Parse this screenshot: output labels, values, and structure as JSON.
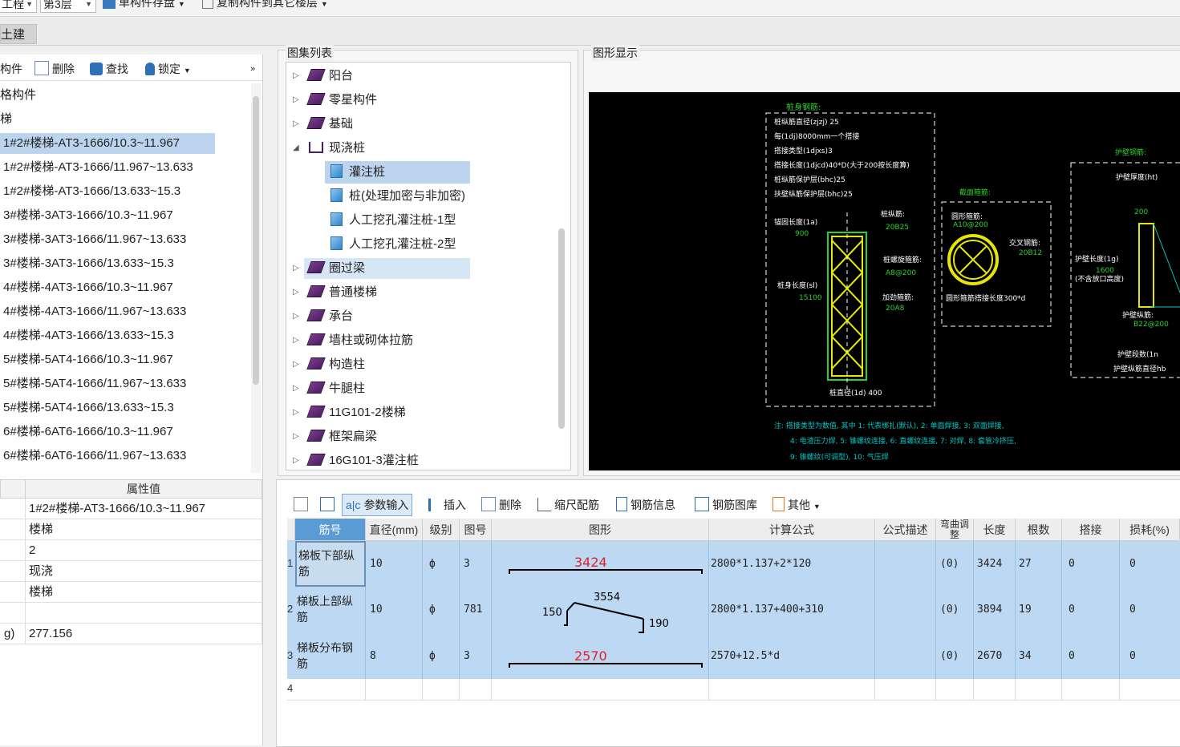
{
  "toolbar": {
    "project_combo": "工程",
    "floor_combo": "第3层",
    "save_single": "单构件存盘",
    "copy_to_floors": "复制构件到其它楼层"
  },
  "tabs": {
    "tujian": "土建"
  },
  "left_toolbar": {
    "component": "构件",
    "delete": "删除",
    "find": "查找",
    "lock": "锁定"
  },
  "left_tree": {
    "group1": "格构件",
    "group2": "梯",
    "items": [
      "1#2#楼梯-AT3-1666/10.3~11.967",
      "1#2#楼梯-AT3-1666/11.967~13.633",
      "1#2#楼梯-AT3-1666/13.633~15.3",
      "3#楼梯-3AT3-1666/10.3~11.967",
      "3#楼梯-3AT3-1666/11.967~13.633",
      "3#楼梯-3AT3-1666/13.633~15.3",
      "4#楼梯-4AT3-1666/10.3~11.967",
      "4#楼梯-4AT3-1666/11.967~13.633",
      "4#楼梯-4AT3-1666/13.633~15.3",
      "5#楼梯-5AT4-1666/10.3~11.967",
      "5#楼梯-5AT4-1666/11.967~13.633",
      "5#楼梯-5AT4-1666/13.633~15.3",
      "6#楼梯-6AT6-1666/10.3~11.967",
      "6#楼梯-6AT6-1666/11.967~13.633"
    ]
  },
  "props": {
    "header_value": "属性值",
    "rows": [
      {
        "name": "",
        "value": "1#2#楼梯-AT3-1666/10.3~11.967"
      },
      {
        "name": "",
        "value": "楼梯"
      },
      {
        "name": "",
        "value": "2"
      },
      {
        "name": "",
        "value": "现浇"
      },
      {
        "name": "",
        "value": "楼梯"
      },
      {
        "name": "",
        "value": ""
      },
      {
        "name": "g)",
        "value": "277.156"
      }
    ]
  },
  "atlas": {
    "title": "图集列表",
    "items": [
      {
        "label": "阳台"
      },
      {
        "label": "零星构件"
      },
      {
        "label": "基础"
      },
      {
        "label": "现浇桩"
      },
      {
        "label": "灌注桩"
      },
      {
        "label": "桩(处理加密与非加密)"
      },
      {
        "label": "人工挖孔灌注桩-1型"
      },
      {
        "label": "人工挖孔灌注桩-2型"
      },
      {
        "label": "圈过梁"
      },
      {
        "label": "普通楼梯"
      },
      {
        "label": "承台"
      },
      {
        "label": "墙柱或砌体拉筋"
      },
      {
        "label": "构造柱"
      },
      {
        "label": "牛腿柱"
      },
      {
        "label": "11G101-2楼梯"
      },
      {
        "label": "框架扁梁"
      },
      {
        "label": "16G101-3灌注桩"
      }
    ]
  },
  "graphic": {
    "title": "图形显示",
    "colors": {
      "bg": "#000000",
      "frame": "#ffffff",
      "green": "#2ad22a",
      "yellow": "#e6e600",
      "cyan": "#00c8c8"
    },
    "pile_rebar_title": "桩身钢筋:",
    "lines": [
      "桩纵筋直径(zjzj) 25",
      "每(1dj)8000mm一个搭接",
      "搭接类型(1djxs)3",
      "搭接长度(1djcd)40*D(大于200按长度算)",
      "桩纵筋保护层(bhc)25",
      "扶壁纵筋保护层(bhc)25"
    ],
    "anchor_len": "锚固长度(1a)",
    "anchor_val": "900",
    "pile_long": "桩纵筋:",
    "pile_long_val": "20B25",
    "spiral": "桩螺旋箍筋:",
    "spiral_val": "A8@200",
    "body_len": "桩身长度(sl)",
    "body_len_val": "15100",
    "stiff": "加劲箍筋:",
    "stiff_val": "20A8",
    "pile_dia": "桩直径(1d) 400",
    "section_title": "截面箍筋:",
    "circle_hoop": "圆形箍筋:",
    "circle_hoop_val": "A10@200",
    "cross": "交叉钢筋:",
    "cross_val": "20B12",
    "circle_lap": "圆形箍筋搭接长度300*d",
    "wall_title": "护壁钢筋:",
    "wall_thick": "护壁厚度(ht)",
    "wall_200": "200",
    "wall_len": "护壁长度(1g)",
    "wall_len_val": "1600",
    "wall_note": "(不含放口高度)",
    "wall_long": "护壁纵筋:",
    "wall_long_val": "B22@200",
    "wall_seg": "护壁段数(1n",
    "wall_dia": "护壁纵筋直径hb",
    "note1": "注: 搭接类型为数值, 其中 1: 代表绑扎(默认), 2: 单面焊接, 3: 双面焊接,",
    "note2": "4: 电渣压力焊, 5: 锥螺纹连接, 6: 直螺纹连接, 7: 对焊, 8: 套管冷挤压,",
    "note3": "9: 锥螺纹(可调型), 10: 气压焊"
  },
  "rebar_toolbar": {
    "param_input": "参数输入",
    "insert": "插入",
    "delete": "删除",
    "scale_rebar": "缩尺配筋",
    "rebar_info": "钢筋信息",
    "rebar_library": "钢筋图库",
    "other": "其他"
  },
  "rebar_table": {
    "headers": [
      "筋号",
      "直径(mm)",
      "级别",
      "图号",
      "图形",
      "计算公式",
      "公式描述",
      "弯曲调整",
      "长度",
      "根数",
      "搭接",
      "损耗(%)"
    ],
    "rows": [
      {
        "no": "1",
        "name": "梯板下部纵筋",
        "dia": "10",
        "grade": "ф",
        "fig": "3",
        "shape_label": "3424",
        "formula": "2800*1.137+2*120",
        "desc": "",
        "bend": "(0)",
        "length": "3424",
        "count": "27",
        "lap": "0",
        "loss": "0"
      },
      {
        "no": "2",
        "name": "梯板上部纵筋",
        "dia": "10",
        "grade": "ф",
        "fig": "781",
        "shape_top": "3554",
        "shape_left": "150",
        "shape_right": "190",
        "formula": "2800*1.137+400+310",
        "desc": "",
        "bend": "(0)",
        "length": "3894",
        "count": "19",
        "lap": "0",
        "loss": "0"
      },
      {
        "no": "3",
        "name": "梯板分布钢筋",
        "dia": "8",
        "grade": "ф",
        "fig": "3",
        "shape_label": "2570",
        "formula": "2570+12.5*d",
        "desc": "",
        "bend": "(0)",
        "length": "2670",
        "count": "34",
        "lap": "0",
        "loss": "0"
      },
      {
        "no": "4"
      }
    ]
  }
}
